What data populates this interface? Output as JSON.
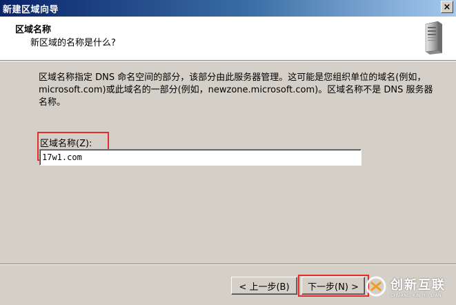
{
  "window": {
    "title": "新建区域向导",
    "close_glyph": "×"
  },
  "header": {
    "title": "区域名称",
    "subtitle": "新区域的名称是什么?",
    "icon": "server-tower-icon"
  },
  "description": {
    "text": "区域名称指定 DNS 命名空间的部分，该部分由此服务器管理。这可能是您组织单位的域名(例如，microsoft.com)或此域名的一部分(例如，newzone.microsoft.com)。区域名称不是 DNS 服务器名称。"
  },
  "zone_field": {
    "label": "区域名称(Z):",
    "value": "17w1.com"
  },
  "buttons": {
    "back_label": "< 上一步(B)",
    "next_label": "下一步(N) >"
  },
  "watermark": {
    "icon": "chuangxin-logo-icon",
    "text_cn": "创新互联",
    "text_en": "CHUANG XIN HU LIAN"
  },
  "colors": {
    "titlebar_start": "#0a246a",
    "titlebar_end": "#a6caf0",
    "dialog_bg": "#d4d0c8",
    "highlight_red": "#e32b2b"
  }
}
